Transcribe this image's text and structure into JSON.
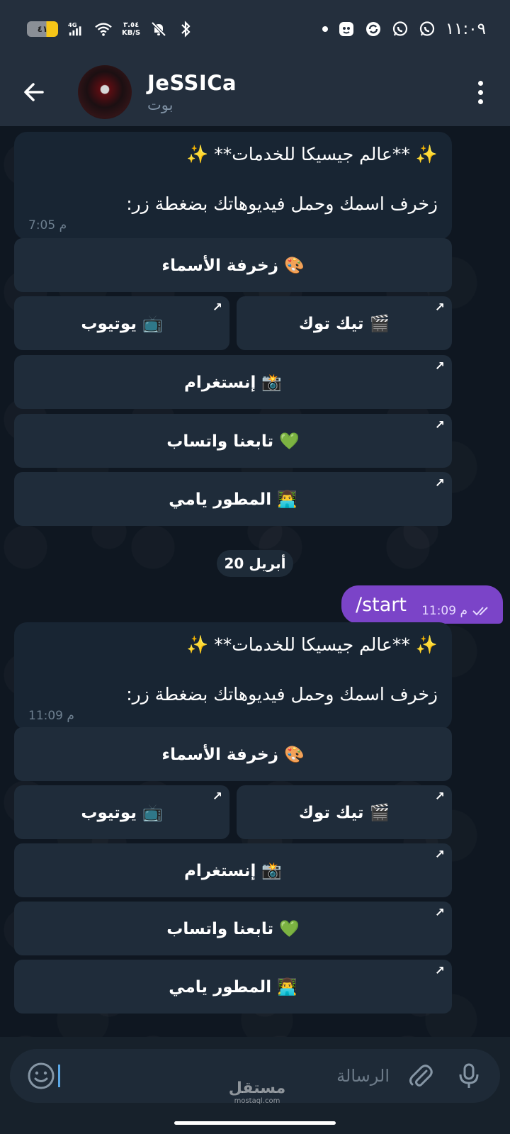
{
  "status_bar": {
    "battery": "٤١",
    "network": "4G",
    "speed_value": "٣.٥٤",
    "speed_unit": "KB/S",
    "time": "١١:٠٩"
  },
  "header": {
    "title": "JeSSICa",
    "subtitle": "بوت"
  },
  "messages": [
    {
      "line1": "✨ **عالم جيسيكا للخدمات** ✨",
      "line2": "زخرف اسمك وحمل فيديوهاتك بضغطة زر:",
      "time": "7:05 م",
      "buttons": {
        "names": "🎨 زخرفة الأسماء",
        "tiktok": "🎬 تيك توك",
        "youtube": "📺 يوتيوب",
        "instagram": "📸 إنستغرام",
        "whatsapp": "💚 تابعنا واتساب",
        "developer": "👨‍💻 المطور يامي"
      }
    },
    {
      "line1": "✨ **عالم جيسيكا للخدمات** ✨",
      "line2": "زخرف اسمك وحمل فيديوهاتك بضغطة زر:",
      "time": "11:09 م",
      "buttons": {
        "names": "🎨 زخرفة الأسماء",
        "tiktok": "🎬 تيك توك",
        "youtube": "📺 يوتيوب",
        "instagram": "📸 إنستغرام",
        "whatsapp": "💚 تابعنا واتساب",
        "developer": "👨‍💻 المطور يامي"
      }
    }
  ],
  "date_separator": "20 أبريل",
  "outgoing": {
    "text": "/start",
    "time": "11:09 م"
  },
  "input": {
    "placeholder": "الرسالة"
  },
  "watermark": {
    "main": "مستقل",
    "sub": "mostaql.com"
  },
  "colors": {
    "header_bg": "#242f3d",
    "incoming_bubble": "#182533",
    "outgoing_bubble": "#7b44c8",
    "keyboard_button": "#1f2c3a"
  }
}
